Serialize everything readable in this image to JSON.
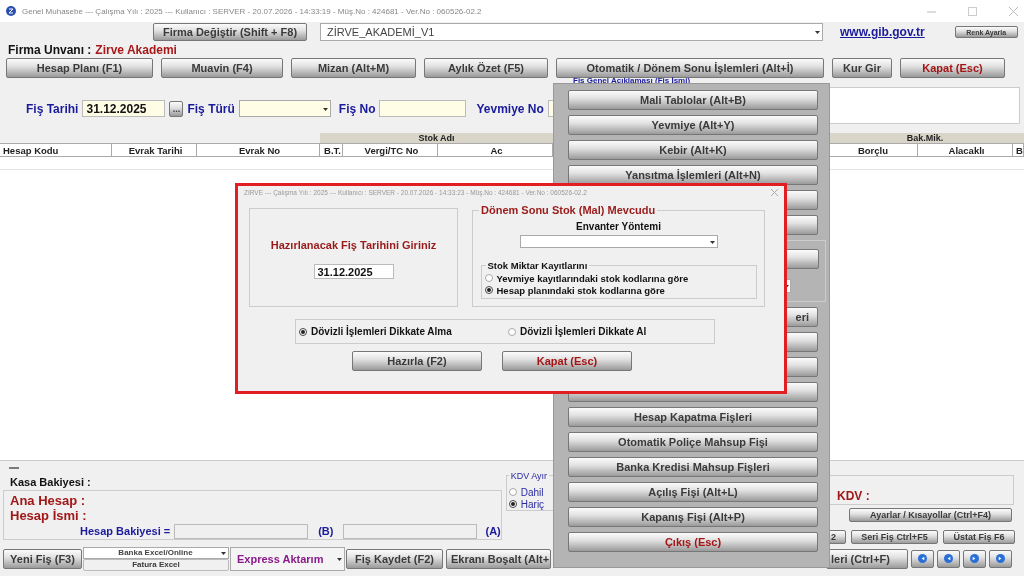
{
  "window": {
    "title": "Genel Muhasebe  ---  Çalışma Yılı : 2025  ---  Kullanıcı : SERVER - 20.07.2026 - 14:33:19 - Müş.No : 424681 - Ver.No : 060526-02.2"
  },
  "top": {
    "firma_button": "Firma Değiştir (Shift + F8)",
    "company_select": "ZİRVE_AKADEMİ_V1",
    "link": "www.gib.gov.tr",
    "color_button": "Renk Ayarla"
  },
  "firma": {
    "label": "Firma Unvanı :",
    "value": "Zirve Akademi"
  },
  "toolbar": [
    {
      "label": "Hesap Planı (F1)",
      "danger": false
    },
    {
      "label": "Muavin (F4)",
      "danger": false
    },
    {
      "label": "Mizan (Alt+M)",
      "danger": false
    },
    {
      "label": "Aylık Özet (F5)",
      "danger": false
    },
    {
      "label": "Otomatik / Dönem Sonu İşlemleri (Alt+İ)",
      "danger": false
    },
    {
      "label": "Kur Gir",
      "danger": false
    },
    {
      "label": "Kapat (Esc)",
      "danger": true
    }
  ],
  "description_label": "Fiş Genel Açıklaması (Fiş İsmi)",
  "voucher": {
    "date_label": "Fiş Tarihi",
    "date": "31.12.2025",
    "browse": "...",
    "type_label": "Fiş Türü",
    "no_label": "Fiş No",
    "journal_label": "Yevmiye No"
  },
  "table": {
    "band_left": "Stok Adı",
    "band_right": "Bak.Mik.",
    "columns_left": [
      "Hesap Kodu",
      "Evrak Tarihi",
      "Evrak No",
      "B.T.",
      "Vergi/TC No",
      "Ac"
    ],
    "columns_right": [
      "Borçlu",
      "Alacaklı",
      "B"
    ]
  },
  "bottom": {
    "cash_label": "Kasa Bakiyesi :",
    "main_account": "Ana Hesap :",
    "account_name": "Hesap İsmi :",
    "balance_label": "Hesap Bakiyesi =",
    "b_label": "(B)",
    "a_label": "(A)",
    "kdv_group": "KDV Ayır",
    "kdv_options": [
      {
        "label": "Dahil",
        "selected": false
      },
      {
        "label": "Hariç",
        "selected": true
      }
    ],
    "kdv_label": "KDV :",
    "settings_button": "Ayarlar / Kısayollar (Ctrl+F4)",
    "small_buttons": [
      "2",
      "Seri Fiş Ctrl+F5",
      "Üstat Fiş F6"
    ]
  },
  "actions": {
    "new": "Yeni Fiş (F3)",
    "bank": "Banka Excel/Online",
    "invoice": "Fatura Excel",
    "express": "Express Aktarım",
    "save": "Fiş Kaydet (F2)",
    "clear": "Ekranı Boşalt (Alt+",
    "filter": "leri (Ctrl+F)"
  },
  "menu_panel": {
    "items": [
      {
        "kind": "button",
        "label": "Mali Tablolar (Alt+B)",
        "danger": false
      },
      {
        "kind": "button",
        "label": "Yevmiye (Alt+Y)",
        "danger": false
      },
      {
        "kind": "button",
        "label": "Kebir (Alt+K)",
        "danger": false
      },
      {
        "kind": "button",
        "label": "Yansıtma İşlemleri (Alt+N)",
        "danger": false
      },
      {
        "kind": "blank"
      },
      {
        "kind": "blank"
      },
      {
        "kind": "group"
      },
      {
        "kind": "tail",
        "label": "eri",
        "danger": false
      },
      {
        "kind": "blank"
      },
      {
        "kind": "blank"
      },
      {
        "kind": "blank"
      },
      {
        "kind": "button",
        "label": "Hesap Kapatma Fişleri",
        "danger": false
      },
      {
        "kind": "button",
        "label": "Otomatik Poliçe Mahsup Fişi",
        "danger": false
      },
      {
        "kind": "button",
        "label": "Banka Kredisi Mahsup Fişleri",
        "danger": false
      },
      {
        "kind": "button",
        "label": "Açılış Fişi (Alt+L)",
        "danger": false
      },
      {
        "kind": "button",
        "label": "Kapanış Fişi (Alt+P)",
        "danger": false
      },
      {
        "kind": "button",
        "label": "Çıkış (Esc)",
        "danger": true
      }
    ]
  },
  "dialog": {
    "title": "ZIRVE  ---  Çalışma Yılı : 2025  ---  Kullanıcı : SERVER - 20.07.2026 - 14:33:23 - Müş.No : 424681 - Ver.No : 060526-02.2",
    "prompt": "Hazırlanacak Fiş Tarihini Giriniz",
    "date": "31.12.2025",
    "stock_group": "Dönem Sonu Stok (Mal) Mevcudu",
    "method_label": "Envanter Yöntemi",
    "records_group": "Stok Miktar Kayıtlarını",
    "record_options": [
      {
        "label": "Yevmiye kayıtlarındaki stok kodlarına göre",
        "selected": false
      },
      {
        "label": "Hesap planındaki stok kodlarına göre",
        "selected": true
      }
    ],
    "fx_options": [
      {
        "label": "Dövizli İşlemleri Dikkate Alma",
        "selected": true
      },
      {
        "label": "Dövizli İşlemleri Dikkate Al",
        "selected": false
      }
    ],
    "buttons": [
      {
        "label": "Hazırla (F2)",
        "danger": false
      },
      {
        "label": "Kapat (Esc)",
        "danger": true
      }
    ]
  }
}
